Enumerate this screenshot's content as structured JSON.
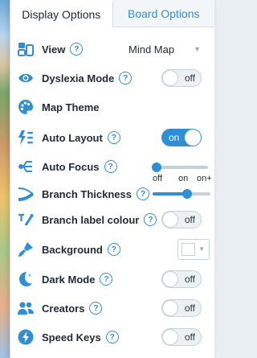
{
  "tabs": {
    "display": "Display Options",
    "board": "Board Options"
  },
  "settings": {
    "view": {
      "label": "View",
      "help": "?",
      "value": "Mind Map",
      "caret": "▼"
    },
    "dyslexia": {
      "label": "Dyslexia Mode",
      "help": "?",
      "state": "off"
    },
    "map_theme": {
      "label": "Map Theme"
    },
    "auto_layout": {
      "label": "Auto Layout",
      "help": "?",
      "state": "on"
    },
    "auto_focus": {
      "label": "Auto Focus",
      "help": "?",
      "value": "off",
      "options": [
        "off",
        "on",
        "on+"
      ]
    },
    "branch_thickness": {
      "label": "Branch Thickness",
      "help": "?",
      "level": 0.6
    },
    "branch_label_colour": {
      "label": "Branch label colour",
      "help": "?",
      "state": "off"
    },
    "background": {
      "label": "Background",
      "help": "?",
      "color": "#ffffff",
      "caret": "▼"
    },
    "dark_mode": {
      "label": "Dark Mode",
      "help": "?",
      "state": "off"
    },
    "creators": {
      "label": "Creators",
      "help": "?",
      "state": "off"
    },
    "speed_keys": {
      "label": "Speed Keys",
      "help": "?",
      "state": "off"
    }
  },
  "colors": {
    "accent": "#2f8fd6",
    "text": "#1f2a36"
  }
}
